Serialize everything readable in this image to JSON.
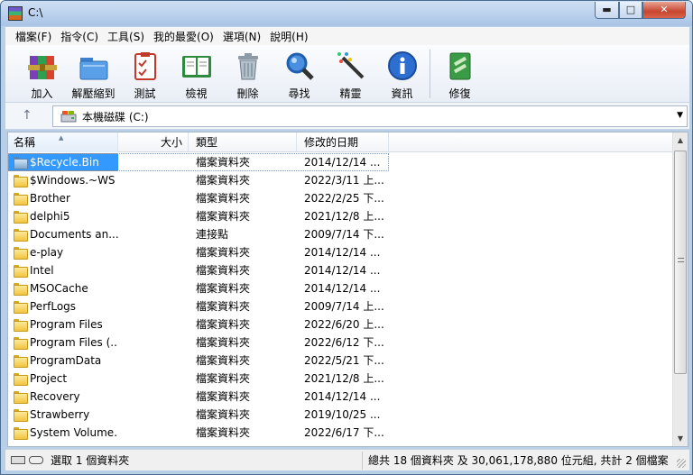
{
  "window": {
    "title": "C:\\",
    "minimize": "▬",
    "maximize": "□",
    "close": "✕"
  },
  "menu": [
    "檔案(F)",
    "指令(C)",
    "工具(S)",
    "我的最愛(O)",
    "選項(N)",
    "說明(H)"
  ],
  "toolbar": {
    "add": "加入",
    "extract": "解壓縮到",
    "test": "測試",
    "view": "檢視",
    "delete": "刪除",
    "find": "尋找",
    "wizard": "精靈",
    "info": "資訊",
    "repair": "修復"
  },
  "address": {
    "up": "↑",
    "path": "本機磁碟 (C:)",
    "dropdown": "▼"
  },
  "columns": {
    "name": "名稱",
    "size": "大小",
    "type": "類型",
    "modified": "修改的日期",
    "sort_indicator": "▲"
  },
  "files": [
    {
      "name": "$Recycle.Bin",
      "size": "",
      "type": "檔案資料夾",
      "modified": "2014/12/14 ...",
      "icon": "recycle-folder-icon",
      "selected": true
    },
    {
      "name": "$Windows.~WS",
      "size": "",
      "type": "檔案資料夾",
      "modified": "2022/3/11 上...",
      "icon": "folder-icon"
    },
    {
      "name": "Brother",
      "size": "",
      "type": "檔案資料夾",
      "modified": "2022/2/25 下...",
      "icon": "folder-icon"
    },
    {
      "name": "delphi5",
      "size": "",
      "type": "檔案資料夾",
      "modified": "2021/12/8 上...",
      "icon": "folder-icon"
    },
    {
      "name": "Documents an...",
      "size": "",
      "type": "連接點",
      "modified": "2009/7/14 下...",
      "icon": "folder-icon"
    },
    {
      "name": "e-play",
      "size": "",
      "type": "檔案資料夾",
      "modified": "2014/12/14 ...",
      "icon": "folder-icon"
    },
    {
      "name": "Intel",
      "size": "",
      "type": "檔案資料夾",
      "modified": "2014/12/14 ...",
      "icon": "folder-icon"
    },
    {
      "name": "MSOCache",
      "size": "",
      "type": "檔案資料夾",
      "modified": "2014/12/14 ...",
      "icon": "folder-icon"
    },
    {
      "name": "PerfLogs",
      "size": "",
      "type": "檔案資料夾",
      "modified": "2009/7/14 上...",
      "icon": "folder-icon"
    },
    {
      "name": "Program Files",
      "size": "",
      "type": "檔案資料夾",
      "modified": "2022/6/20 上...",
      "icon": "folder-icon"
    },
    {
      "name": "Program Files (...",
      "size": "",
      "type": "檔案資料夾",
      "modified": "2022/6/12 下...",
      "icon": "folder-icon"
    },
    {
      "name": "ProgramData",
      "size": "",
      "type": "檔案資料夾",
      "modified": "2022/5/21 下...",
      "icon": "folder-icon"
    },
    {
      "name": "Project",
      "size": "",
      "type": "檔案資料夾",
      "modified": "2021/12/8 上...",
      "icon": "folder-icon"
    },
    {
      "name": "Recovery",
      "size": "",
      "type": "檔案資料夾",
      "modified": "2014/12/14 ...",
      "icon": "folder-icon"
    },
    {
      "name": "Strawberry",
      "size": "",
      "type": "檔案資料夾",
      "modified": "2019/10/25 ...",
      "icon": "folder-icon"
    },
    {
      "name": "System Volume...",
      "size": "",
      "type": "檔案資料夾",
      "modified": "2022/6/17 下...",
      "icon": "folder-icon"
    }
  ],
  "status": {
    "left": "選取 1 個資料夾",
    "right": "總共 18 個資料夾 及 30,061,178,880 位元組, 共計 2 個檔案"
  }
}
